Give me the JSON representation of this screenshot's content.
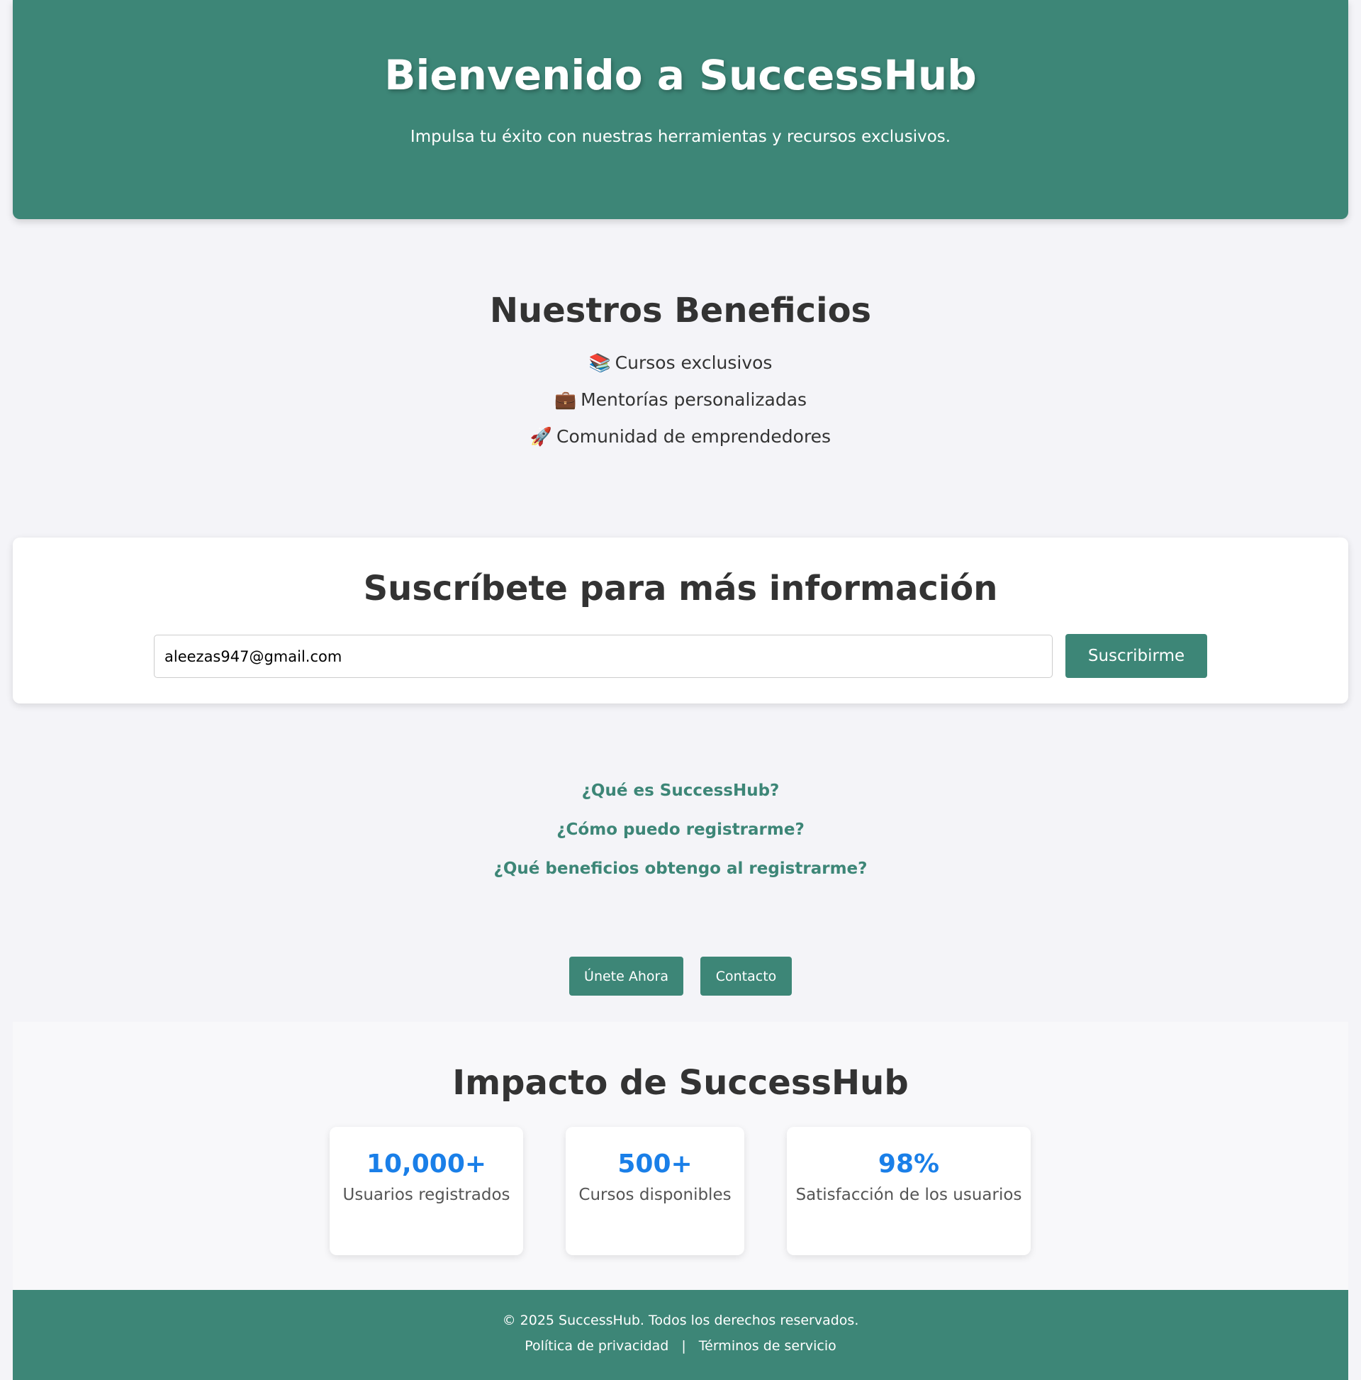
{
  "hero": {
    "title": "Bienvenido a SuccessHub",
    "subtitle": "Impulsa tu éxito con nuestras herramientas y recursos exclusivos."
  },
  "benefits": {
    "title": "Nuestros Beneficios",
    "items": [
      {
        "emoji": "📚",
        "icon": "books-icon",
        "label": "Cursos exclusivos"
      },
      {
        "emoji": "💼",
        "icon": "briefcase-icon",
        "label": "Mentorías personalizadas"
      },
      {
        "emoji": "🚀",
        "icon": "rocket-icon",
        "label": "Comunidad de emprendedores"
      }
    ]
  },
  "subscribe": {
    "title": "Suscríbete para más información",
    "email_value": "aleezas947@gmail.com",
    "button_label": "Suscribirme"
  },
  "faq": {
    "items": [
      "¿Qué es SuccessHub?",
      "¿Cómo puedo registrarme?",
      "¿Qué beneficios obtengo al registrarme?"
    ]
  },
  "cta": {
    "join_label": "Únete Ahora",
    "contact_label": "Contacto"
  },
  "impact": {
    "title": "Impacto de SuccessHub",
    "stats": [
      {
        "value": "10,000+",
        "label": "Usuarios registrados"
      },
      {
        "value": "500+",
        "label": "Cursos disponibles"
      },
      {
        "value": "98%",
        "label": "Satisfacción de los usuarios"
      }
    ]
  },
  "footer": {
    "copyright": "© 2025 SuccessHub. Todos los derechos reservados.",
    "privacy_label": "Política de privacidad",
    "separator": "|",
    "terms_label": "Términos de servicio"
  },
  "colors": {
    "brand": "#3d8677",
    "stat_accent": "#1a7fe8",
    "background": "#f4f4f8"
  }
}
